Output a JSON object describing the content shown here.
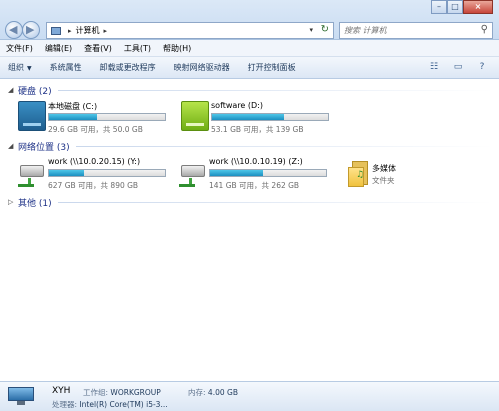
{
  "address": {
    "crumbs": [
      "计算机"
    ]
  },
  "search": {
    "placeholder": "搜索 计算机"
  },
  "menu": [
    "文件(F)",
    "编辑(E)",
    "查看(V)",
    "工具(T)",
    "帮助(H)"
  ],
  "toolbar": {
    "organize": "组织",
    "system_properties": "系统属性",
    "uninstall": "卸载或更改程序",
    "map_drive": "映射网络驱动器",
    "control_panel": "打开控制面板"
  },
  "groups": {
    "hdd": {
      "title": "硬盘 (2)"
    },
    "network": {
      "title": "网络位置 (3)"
    },
    "other": {
      "title": "其他 (1)"
    }
  },
  "drives": [
    {
      "name": "本地磁盘 (C:)",
      "size": "29.6 GB 可用，共 50.0 GB",
      "used_fraction": 0.41,
      "color": "#2b7ab5"
    },
    {
      "name": "software (D:)",
      "size": "53.1 GB 可用，共 139 GB",
      "used_fraction": 0.62,
      "color": "#8fd026"
    }
  ],
  "network_locations": [
    {
      "name": "work (\\\\10.0.20.15) (Y:)",
      "size": "627 GB 可用，共 890 GB",
      "used_fraction": 0.3
    },
    {
      "name": "work (\\\\10.0.10.19) (Z:)",
      "size": "141 GB 可用，共 262 GB",
      "used_fraction": 0.46
    },
    {
      "name": "多媒体",
      "type": "文件夹"
    }
  ],
  "details": {
    "computer_name": "XYH",
    "workgroup_label": "工作组:",
    "workgroup": "WORKGROUP",
    "memory_label": "内存:",
    "memory": "4.00 GB",
    "cpu_label": "处理器:",
    "cpu": "Intel(R) Core(TM) i5-3..."
  },
  "icons": {
    "back": "back-arrow-icon",
    "forward": "forward-arrow-icon",
    "refresh": "refresh-icon",
    "search": "search-icon",
    "views": "views-icon",
    "preview": "preview-pane-icon",
    "help": "help-icon"
  }
}
